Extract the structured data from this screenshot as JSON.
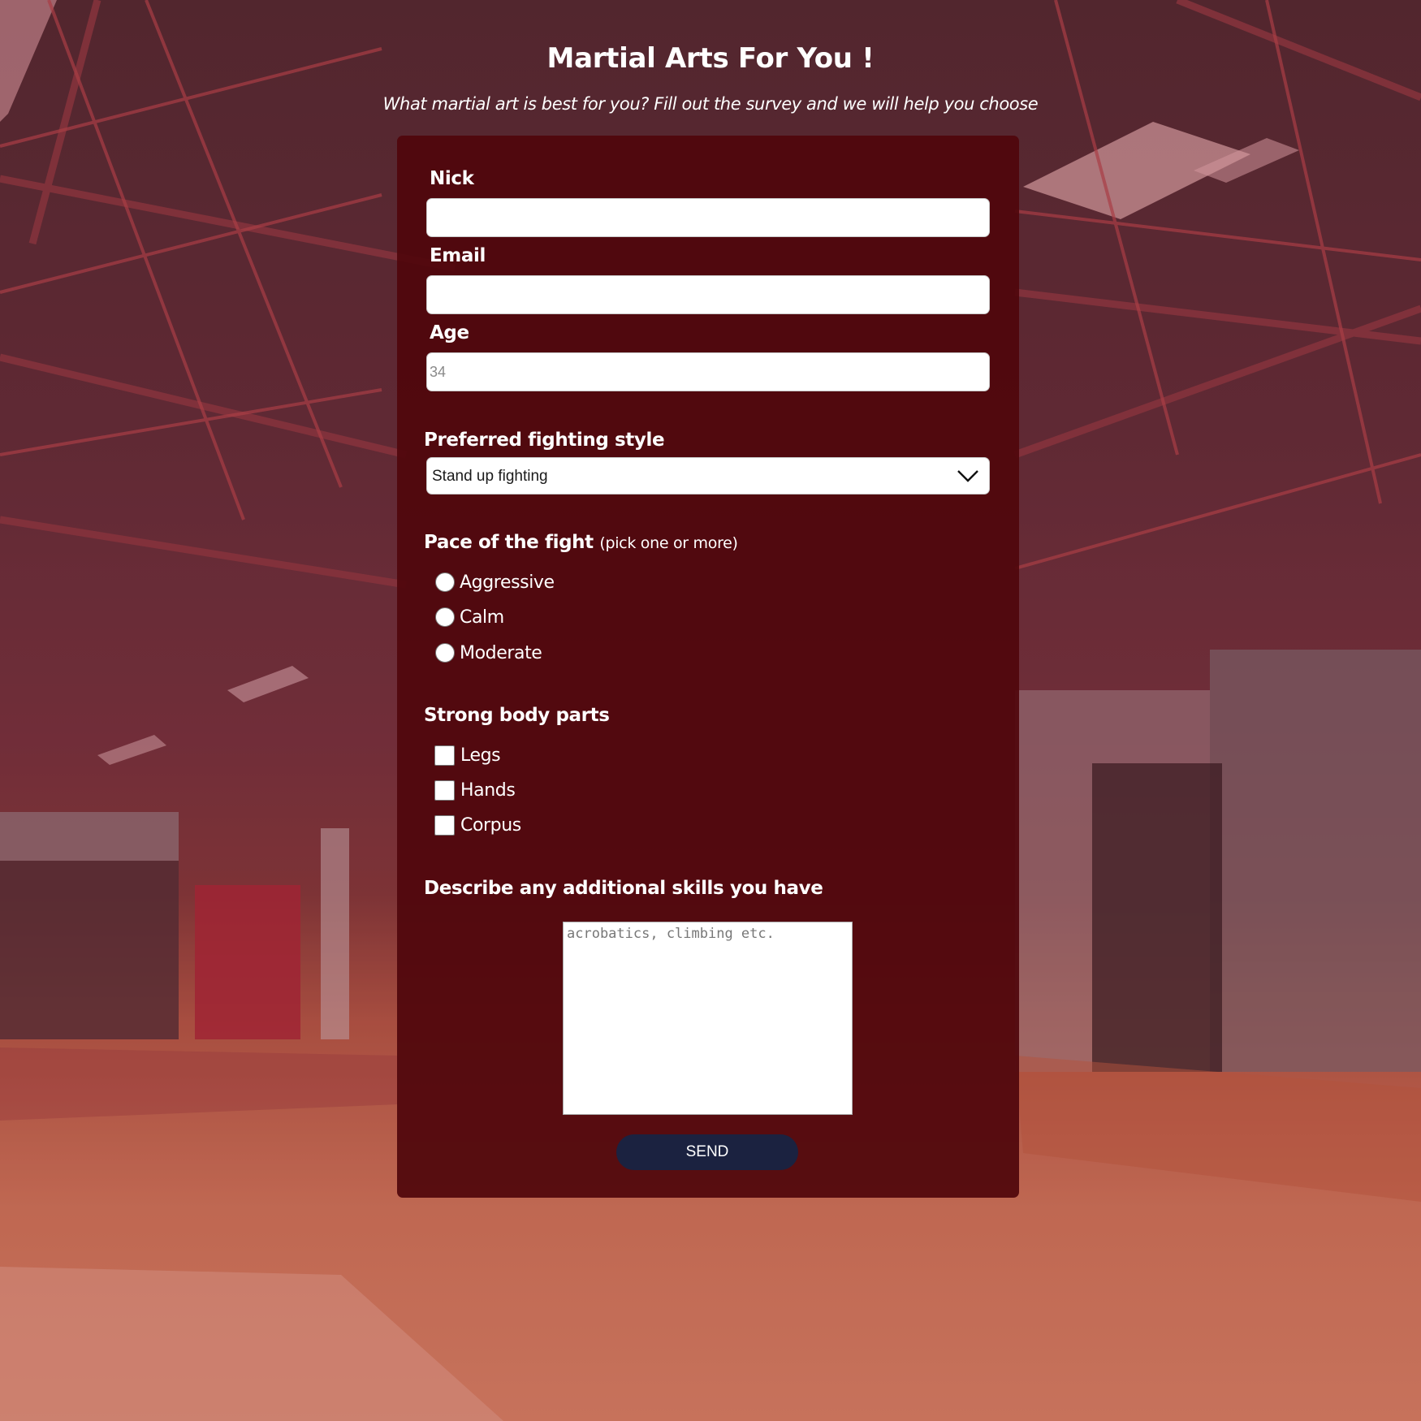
{
  "header": {
    "title": "Martial Arts For You !",
    "subtitle": "What martial art is best for you? Fill out the survey and we will help you choose"
  },
  "form": {
    "nick": {
      "label": "Nick",
      "value": "",
      "placeholder": ""
    },
    "email": {
      "label": "Email",
      "value": "",
      "placeholder": ""
    },
    "age": {
      "label": "Age",
      "value": "",
      "placeholder": "34"
    },
    "style": {
      "label": "Preferred fighting style",
      "selected": "Stand up fighting"
    },
    "pace": {
      "label": "Pace of the fight",
      "hint": "(pick one or more)",
      "options": [
        "Aggressive",
        "Calm",
        "Moderate"
      ]
    },
    "body_parts": {
      "label": "Strong body parts",
      "options": [
        "Legs",
        "Hands",
        "Corpus"
      ]
    },
    "skills": {
      "label": "Describe any additional skills you have",
      "placeholder": "acrobatics, climbing etc."
    },
    "send_label": "SEND"
  },
  "colors": {
    "card": "#50060c",
    "button": "#1b2240",
    "text": "#ffffff"
  }
}
